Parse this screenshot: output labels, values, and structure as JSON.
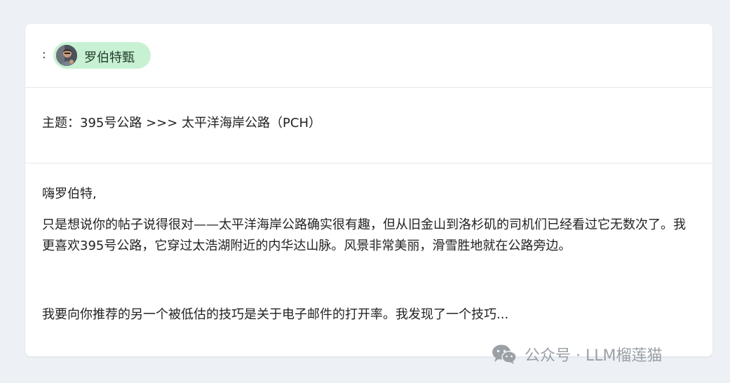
{
  "recipient": {
    "label": ":",
    "name": "罗伯特甄"
  },
  "email": {
    "subject": "主题：395号公路 >>> 太平洋海岸公路（PCH）",
    "greeting": "嗨罗伯特,",
    "paragraph1": "只是想说你的帖子说得很对——太平洋海岸公路确实很有趣，但从旧金山到洛杉矶的司机们已经看过它无数次了。我更喜欢395号公路，它穿过太浩湖附近的内华达山脉。风景非常美丽，滑雪胜地就在公路旁边。",
    "paragraph2": "我要向你推荐的另一个被低估的技巧是关于电子邮件的打开率。我发现了一个技巧..."
  },
  "watermark": {
    "text": "公众号 · LLM榴莲猫",
    "icon": "wechat-icon"
  },
  "colors": {
    "background": "#edf1f5",
    "card": "#ffffff",
    "chip": "#c8f1d4",
    "divider": "#e4e7ea",
    "watermark": "#9aa0a6"
  }
}
